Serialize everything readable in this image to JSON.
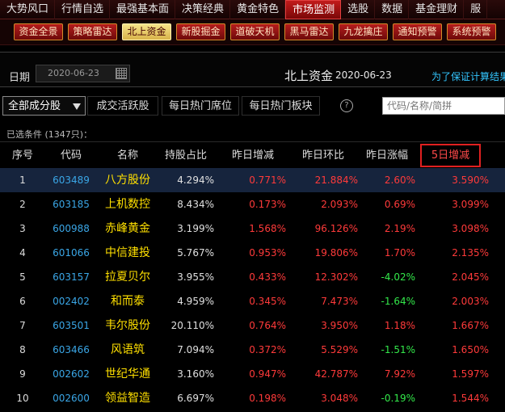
{
  "topnav": [
    "大势风口",
    "行情自选",
    "最强基本面",
    "决策经典",
    "黄金特色",
    "市场监测",
    "选股",
    "数据",
    "基金理财",
    "服"
  ],
  "topnav_active": 5,
  "subbar": [
    "资金全景",
    "策略雷达",
    "北上资金",
    "新股掘金",
    "道破天机",
    "黑马雷达",
    "九龙擒庄",
    "通知预警",
    "系统预警"
  ],
  "subbar_active": 2,
  "datebar": {
    "label": "日期",
    "date_value": "2020-06-23",
    "title": "北上资金",
    "title_date": "2020-06-23",
    "note": "为了保证计算结果"
  },
  "tabs": [
    "全部成分股",
    "成交活跃股",
    "每日热门席位",
    "每日热门板块"
  ],
  "help_glyph": "?",
  "search_placeholder": "代码/名称/简拼",
  "condition": "已选条件 (1347只)：",
  "headers": [
    "序号",
    "代码",
    "名称",
    "持股占比",
    "昨日增减",
    "昨日环比",
    "昨日涨幅",
    "5日增减"
  ],
  "sorted_col": 7,
  "rows": [
    {
      "idx": "1",
      "code": "603489",
      "name": "八方股份",
      "ratio": "4.294%",
      "chg": "0.771%",
      "qoq": "21.884%",
      "pct": "2.60%",
      "dir": "up",
      "d5": "3.590%"
    },
    {
      "idx": "2",
      "code": "603185",
      "name": "上机数控",
      "ratio": "8.434%",
      "chg": "0.173%",
      "qoq": "2.093%",
      "pct": "0.69%",
      "dir": "up",
      "d5": "3.099%"
    },
    {
      "idx": "3",
      "code": "600988",
      "name": "赤峰黄金",
      "ratio": "3.199%",
      "chg": "1.568%",
      "qoq": "96.126%",
      "pct": "2.19%",
      "dir": "up",
      "d5": "3.098%"
    },
    {
      "idx": "4",
      "code": "601066",
      "name": "中信建投",
      "ratio": "5.767%",
      "chg": "0.953%",
      "qoq": "19.806%",
      "pct": "1.70%",
      "dir": "up",
      "d5": "2.135%"
    },
    {
      "idx": "5",
      "code": "603157",
      "name": "拉夏贝尔",
      "ratio": "3.955%",
      "chg": "0.433%",
      "qoq": "12.302%",
      "pct": "-4.02%",
      "dir": "down",
      "d5": "2.045%"
    },
    {
      "idx": "6",
      "code": "002402",
      "name": "和而泰",
      "ratio": "4.959%",
      "chg": "0.345%",
      "qoq": "7.473%",
      "pct": "-1.64%",
      "dir": "down",
      "d5": "2.003%"
    },
    {
      "idx": "7",
      "code": "603501",
      "name": "韦尔股份",
      "ratio": "20.110%",
      "chg": "0.764%",
      "qoq": "3.950%",
      "pct": "1.18%",
      "dir": "up",
      "d5": "1.667%"
    },
    {
      "idx": "8",
      "code": "603466",
      "name": "风语筑",
      "ratio": "7.094%",
      "chg": "0.372%",
      "qoq": "5.529%",
      "pct": "-1.51%",
      "dir": "down",
      "d5": "1.650%"
    },
    {
      "idx": "9",
      "code": "002602",
      "name": "世纪华通",
      "ratio": "3.160%",
      "chg": "0.947%",
      "qoq": "42.787%",
      "pct": "7.92%",
      "dir": "up",
      "d5": "1.597%"
    },
    {
      "idx": "10",
      "code": "002600",
      "name": "领益智造",
      "ratio": "6.697%",
      "chg": "0.198%",
      "qoq": "3.048%",
      "pct": "-0.19%",
      "dir": "down",
      "d5": "1.544%"
    }
  ],
  "selected_row": 0,
  "colors": {
    "up": "#ff3a3a",
    "down": "#33e84a",
    "code": "#3aa6e6",
    "name": "#ffe000",
    "link": "#33c6ff"
  }
}
